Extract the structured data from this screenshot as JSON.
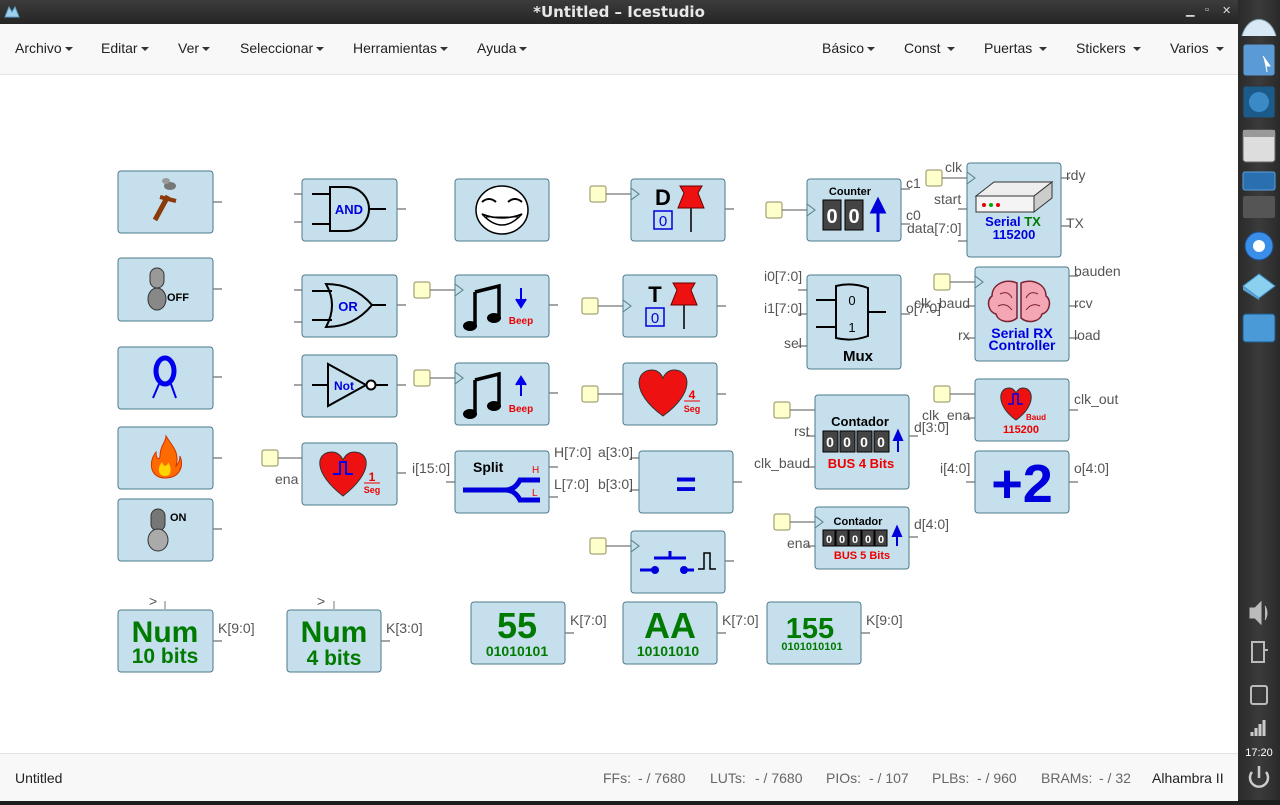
{
  "window": {
    "title": "*Untitled – Icestudio"
  },
  "menubar": {
    "left": [
      "Archivo",
      "Editar",
      "Ver",
      "Seleccionar",
      "Herramientas",
      "Ayuda"
    ],
    "right": [
      "Básico",
      "Const",
      "Puertas",
      "Stickers",
      "Varios"
    ]
  },
  "blocks": {
    "and": "AND",
    "or": "OR",
    "not": "Not",
    "off": "OFF",
    "on": "ON",
    "beep": "Beep",
    "d_flipflop": "D",
    "d_init": "0",
    "t_flipflop": "T",
    "t_init": "0",
    "heart_sec_num": "1",
    "heart_sec_unit": "Seg",
    "heart4_num": "4",
    "heart4_unit": "Seg",
    "split": "Split",
    "split_h": "H",
    "split_l": "L",
    "equal": "=",
    "counter_title": "Counter",
    "counter_digits": [
      "0",
      "0"
    ],
    "mux_title": "Mux",
    "mux_in0": "0",
    "mux_in1": "1",
    "serial_tx_line1_a": "Serial",
    "serial_tx_line1_b": "TX",
    "serial_tx_line2": "115200",
    "serial_rx_line1": "Serial RX",
    "serial_rx_line2": "Controller",
    "baud_label": "Baud",
    "baud_value": "115200",
    "contador4_title": "Contador",
    "contador4_digits": [
      "0",
      "0",
      "0",
      "0"
    ],
    "contador4_bus": "BUS 4 Bits",
    "contador5_title": "Contador",
    "contador5_digits": [
      "0",
      "0",
      "0",
      "0",
      "0"
    ],
    "contador5_bus": "BUS 5 Bits",
    "plus2": "+2",
    "num10_title": "Num",
    "num10_sub": "10 bits",
    "num4_title": "Num",
    "num4_sub": "4 bits",
    "c55_value": "55",
    "c55_bits": "01010101",
    "cAA_value": "AA",
    "cAA_bits": "10101010",
    "c155_value": "155",
    "c155_bits": "0101010101"
  },
  "port_labels": {
    "ena": "ena",
    "i15": "i[15:0]",
    "h70": "H[7:0]",
    "l70": "L[7:0]",
    "a30": "a[3:0]",
    "b30": "b[3:0]",
    "c1": "c1",
    "c0": "c0",
    "data70": "data[7:0]",
    "clk": "clk",
    "start": "start",
    "rdy": "rdy",
    "tx": "TX",
    "i0_70": "i0[7:0]",
    "i1_70": "i1[7:0]",
    "sel": "sel",
    "o70": "o[7:0]",
    "clk_baud": "clk_baud",
    "rx": "rx",
    "bauden": "bauden",
    "rcv": "rcv",
    "load": "load",
    "rst": "rst",
    "clk_baud2": "clk_baud",
    "d30": "d[3:0]",
    "clk_ena": "clk_ena",
    "clk_out": "clk_out",
    "i40": "i[4:0]",
    "o40": "o[4:0]",
    "ena2": "ena",
    "d40": "d[4:0]",
    "k90": "K[9:0]",
    "k30": "K[3:0]",
    "k70a": "K[7:0]",
    "k70b": "K[7:0]",
    "k90b": "K[9:0]",
    "gt1": ">",
    "gt2": ">"
  },
  "status": {
    "file": "Untitled",
    "ffs": "FFs:",
    "ffs_val": "- / 7680",
    "luts": "LUTs:",
    "luts_val": "- / 7680",
    "pios": "PIOs:",
    "pios_val": "- / 107",
    "plbs": "PLBs:",
    "plbs_val": "- / 960",
    "brams": "BRAMs:",
    "brams_val": "- / 32",
    "board": "Alhambra II"
  },
  "dock": {
    "clock": "17:20"
  },
  "colors": {
    "block_fill": "#c5e0ec",
    "block_stroke": "#4e7a8a",
    "blue_text": "#0000dd",
    "red_text": "#ee0000",
    "green_text": "#007a00",
    "const_input": "#ffffcc"
  }
}
